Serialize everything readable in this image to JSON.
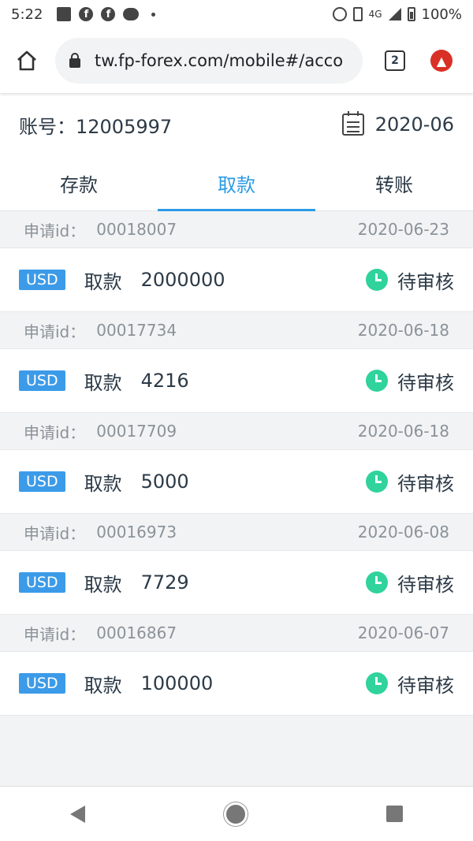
{
  "status_bar": {
    "time": "5:22",
    "network": "4G",
    "battery": "100%"
  },
  "browser": {
    "url": "tw.fp-forex.com/mobile#/acco",
    "tab_count": "2"
  },
  "account": {
    "label": "账号：12005997",
    "date": "2020-06"
  },
  "tabs": [
    {
      "label": "存款",
      "active": false
    },
    {
      "label": "取款",
      "active": true
    },
    {
      "label": "转账",
      "active": false
    }
  ],
  "records": [
    {
      "id_label": "申请id：",
      "id": "00018007",
      "date": "2020-06-23",
      "currency": "USD",
      "type": "取款",
      "amount": "2000000",
      "status": "待审核"
    },
    {
      "id_label": "申请id：",
      "id": "00017734",
      "date": "2020-06-18",
      "currency": "USD",
      "type": "取款",
      "amount": "4216",
      "status": "待审核"
    },
    {
      "id_label": "申请id：",
      "id": "00017709",
      "date": "2020-06-18",
      "currency": "USD",
      "type": "取款",
      "amount": "5000",
      "status": "待审核"
    },
    {
      "id_label": "申请id：",
      "id": "00016973",
      "date": "2020-06-08",
      "currency": "USD",
      "type": "取款",
      "amount": "7729",
      "status": "待审核"
    },
    {
      "id_label": "申请id：",
      "id": "00016867",
      "date": "2020-06-07",
      "currency": "USD",
      "type": "取款",
      "amount": "100000",
      "status": "待审核"
    }
  ],
  "colors": {
    "accent": "#2b9be6",
    "badge": "#3c9be8",
    "status_icon": "#2fd39b",
    "update": "#d93025"
  }
}
